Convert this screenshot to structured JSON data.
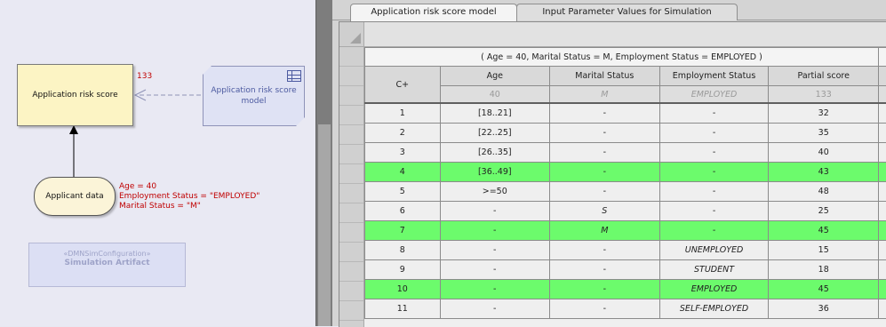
{
  "diagram": {
    "decision": {
      "label": "Application risk score",
      "score": "133"
    },
    "bkm": {
      "label": "Application risk score model"
    },
    "input_data": {
      "label": "Applicant data",
      "values": [
        "Age = 40",
        "Employment Status = \"EMPLOYED\"",
        "Marital Status = \"M\""
      ]
    },
    "artifact": {
      "stereotype": "«DMNSimConfiguration»",
      "name": "Simulation Artifact"
    }
  },
  "tabs": [
    {
      "label": "Application risk score model",
      "active": true
    },
    {
      "label": "Input Parameter Values for Simulation",
      "active": false
    }
  ],
  "decision_table": {
    "condition": "( Age = 40, Marital Status = M, Employment Status = EMPLOYED )",
    "hit_policy": "C+",
    "columns": [
      "Age",
      "Marital Status",
      "Employment Status",
      "Partial score"
    ],
    "simulation_values": [
      "40",
      "M",
      "EMPLOYED",
      "133"
    ],
    "rows": [
      {
        "num": "1",
        "age": "[18..21]",
        "marital": "-",
        "employment": "-",
        "score": "32",
        "highlighted": false
      },
      {
        "num": "2",
        "age": "[22..25]",
        "marital": "-",
        "employment": "-",
        "score": "35",
        "highlighted": false
      },
      {
        "num": "3",
        "age": "[26..35]",
        "marital": "-",
        "employment": "-",
        "score": "40",
        "highlighted": false
      },
      {
        "num": "4",
        "age": "[36..49]",
        "marital": "-",
        "employment": "-",
        "score": "43",
        "highlighted": true
      },
      {
        "num": "5",
        "age": ">=50",
        "marital": "-",
        "employment": "-",
        "score": "48",
        "highlighted": false
      },
      {
        "num": "6",
        "age": "-",
        "marital": "S",
        "employment": "-",
        "score": "25",
        "highlighted": false
      },
      {
        "num": "7",
        "age": "-",
        "marital": "M",
        "employment": "-",
        "score": "45",
        "highlighted": true
      },
      {
        "num": "8",
        "age": "-",
        "marital": "-",
        "employment": "UNEMPLOYED",
        "score": "15",
        "highlighted": false
      },
      {
        "num": "9",
        "age": "-",
        "marital": "-",
        "employment": "STUDENT",
        "score": "18",
        "highlighted": false
      },
      {
        "num": "10",
        "age": "-",
        "marital": "-",
        "employment": "EMPLOYED",
        "score": "45",
        "highlighted": true
      },
      {
        "num": "11",
        "age": "-",
        "marital": "-",
        "employment": "SELF-EMPLOYED",
        "score": "36",
        "highlighted": false
      }
    ]
  },
  "colors": {
    "highlight": "#6cfb6c",
    "result_text": "#c00000",
    "bkm_text": "#4c5aa0"
  }
}
